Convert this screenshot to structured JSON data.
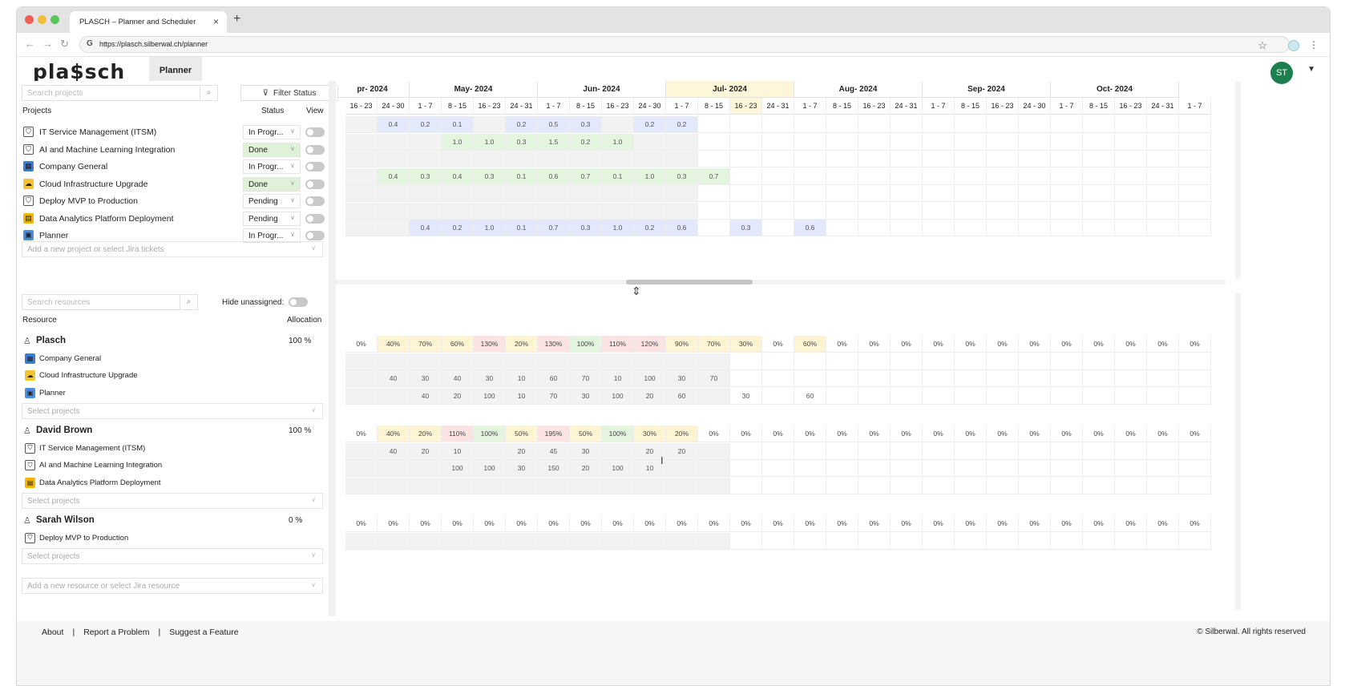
{
  "browser": {
    "tab_title": "PLASCH – Planner and Scheduler",
    "url": "https://plasch.silberwal.ch/planner"
  },
  "app": {
    "logo": "pla$sch",
    "nav_tab": "Planner",
    "avatar": "ST"
  },
  "projects_panel": {
    "search_placeholder": "Search projects",
    "filter_label": "Filter Status",
    "col_projects": "Projects",
    "col_status": "Status",
    "col_view": "View",
    "add_placeholder": "Add a new project or select Jira tickets",
    "rows": [
      {
        "name": "IT Service Management (ITSM)",
        "status": "In Progr...",
        "icon": "shield-check-icon",
        "color": "#ffffff"
      },
      {
        "name": "AI and Machine Learning Integration",
        "status": "Done",
        "icon": "shield-check-icon",
        "color": "#ffffff"
      },
      {
        "name": "Company General",
        "status": "In Progr...",
        "icon": "building-icon",
        "color": "#3b7dd8"
      },
      {
        "name": "Cloud Infrastructure Upgrade",
        "status": "Done",
        "icon": "cloud-icon",
        "color": "#f4c430"
      },
      {
        "name": "Deploy MVP to Production",
        "status": "Pending",
        "icon": "shield-check-icon",
        "color": "#ffffff"
      },
      {
        "name": "Data Analytics Platform Deployment",
        "status": "Pending",
        "icon": "chart-icon",
        "color": "#f4b400"
      },
      {
        "name": "Planner",
        "status": "In Progr...",
        "icon": "planner-icon",
        "color": "#4a90e2"
      }
    ]
  },
  "resources_panel": {
    "search_placeholder": "Search resources",
    "hide_label": "Hide unassigned:",
    "col_resource": "Resource",
    "col_allocation": "Allocation",
    "select_projects": "Select projects",
    "add_placeholder": "Add a new resource or select Jira resource",
    "resources": [
      {
        "name": "Plasch",
        "allocation": "100 %",
        "projects": [
          "Company General",
          "Cloud Infrastructure Upgrade",
          "Planner"
        ]
      },
      {
        "name": "David Brown",
        "allocation": "100 %",
        "projects": [
          "IT Service Management (ITSM)",
          "AI and Machine Learning Integration",
          "Data Analytics Platform Deployment"
        ]
      },
      {
        "name": "Sarah Wilson",
        "allocation": "0 %",
        "projects": [
          "Deploy MVP to Production"
        ]
      }
    ]
  },
  "timeline": {
    "months": [
      "pr- 2024",
      "May- 2024",
      "Jun- 2024",
      "Jul- 2024",
      "Aug- 2024",
      "Sep- 2024",
      "Oct- 2024"
    ],
    "weeks": [
      "16 - 23",
      "24 - 30",
      "1 - 7",
      "8 - 15",
      "16 - 23",
      "24 - 31",
      "1 - 7",
      "8 - 15",
      "16 - 23",
      "24 - 30",
      "1 - 7",
      "8 - 15",
      "16 - 23",
      "24 - 31",
      "1 - 7",
      "8 - 15",
      "16 - 23",
      "24 - 31",
      "1 - 7",
      "8 - 15",
      "16 - 23",
      "24 - 30",
      "1 - 7",
      "8 - 15",
      "16 - 23",
      "24 - 31",
      "1 - 7"
    ],
    "project_values": [
      [
        "",
        "0.4",
        "0.2",
        "0.1",
        "",
        "0.2",
        "0.5",
        "0.3",
        "",
        "0.2",
        "0.2",
        "",
        "",
        "",
        "",
        "",
        "",
        "",
        "",
        "",
        "",
        "",
        "",
        "",
        "",
        "",
        ""
      ],
      [
        "",
        "",
        "",
        "1.0",
        "1.0",
        "0.3",
        "1.5",
        "0.2",
        "1.0",
        "",
        "",
        "",
        "",
        "",
        "",
        "",
        "",
        "",
        "",
        "",
        "",
        "",
        "",
        "",
        "",
        "",
        ""
      ],
      [
        "",
        "",
        "",
        "",
        "",
        "",
        "",
        "",
        "",
        "",
        "",
        "",
        "",
        "",
        "",
        "",
        "",
        "",
        "",
        "",
        "",
        "",
        "",
        "",
        "",
        "",
        ""
      ],
      [
        "",
        "0.4",
        "0.3",
        "0.4",
        "0.3",
        "0.1",
        "0.6",
        "0.7",
        "0.1",
        "1.0",
        "0.3",
        "0.7",
        "",
        "",
        "",
        "",
        "",
        "",
        "",
        "",
        "",
        "",
        "",
        "",
        "",
        "",
        ""
      ],
      [
        "",
        "",
        "",
        "",
        "",
        "",
        "",
        "",
        "",
        "",
        "",
        "",
        "",
        "",
        "",
        "",
        "",
        "",
        "",
        "",
        "",
        "",
        "",
        "",
        "",
        "",
        ""
      ],
      [
        "",
        "",
        "",
        "",
        "",
        "",
        "",
        "",
        "",
        "",
        "",
        "",
        "",
        "",
        "",
        "",
        "",
        "",
        "",
        "",
        "",
        "",
        "",
        "",
        "",
        "",
        ""
      ],
      [
        "",
        "",
        "0.4",
        "0.2",
        "1.0",
        "0.1",
        "0.7",
        "0.3",
        "1.0",
        "0.2",
        "0.6",
        "",
        "0.3",
        "",
        "0.6",
        "",
        "",
        "",
        "",
        "",
        "",
        "",
        "",
        "",
        "",
        "",
        ""
      ]
    ],
    "plasch_pct": [
      "0%",
      "40%",
      "70%",
      "60%",
      "130%",
      "20%",
      "130%",
      "100%",
      "110%",
      "120%",
      "90%",
      "70%",
      "30%",
      "0%",
      "60%",
      "0%",
      "0%",
      "0%",
      "0%",
      "0%",
      "0%",
      "0%",
      "0%",
      "0%",
      "0%",
      "0%",
      "0%"
    ],
    "plasch_rows": [
      [
        "",
        "",
        "",
        "",
        "",
        "",
        "",
        "",
        "",
        "",
        "",
        "",
        "",
        "",
        "",
        "",
        "",
        "",
        "",
        "",
        "",
        "",
        "",
        "",
        "",
        "",
        ""
      ],
      [
        "",
        "40",
        "30",
        "40",
        "30",
        "10",
        "60",
        "70",
        "10",
        "100",
        "30",
        "70",
        "",
        "",
        "",
        "",
        "",
        "",
        "",
        "",
        "",
        "",
        "",
        "",
        "",
        "",
        ""
      ],
      [
        "",
        "",
        "40",
        "20",
        "100",
        "10",
        "70",
        "30",
        "100",
        "20",
        "60",
        "",
        "30",
        "",
        "60",
        "",
        "",
        "",
        "",
        "",
        "",
        "",
        "",
        "",
        "",
        "",
        ""
      ]
    ],
    "david_pct": [
      "0%",
      "40%",
      "20%",
      "110%",
      "100%",
      "50%",
      "195%",
      "50%",
      "100%",
      "30%",
      "20%",
      "0%",
      "0%",
      "0%",
      "0%",
      "0%",
      "0%",
      "0%",
      "0%",
      "0%",
      "0%",
      "0%",
      "0%",
      "0%",
      "0%",
      "0%",
      "0%"
    ],
    "david_rows": [
      [
        "",
        "40",
        "20",
        "10",
        "",
        "20",
        "45",
        "30",
        "",
        "20",
        "20",
        "",
        "",
        "",
        "",
        "",
        "",
        "",
        "",
        "",
        "",
        "",
        "",
        "",
        "",
        "",
        ""
      ],
      [
        "",
        "",
        "",
        "100",
        "100",
        "30",
        "150",
        "20",
        "100",
        "10",
        "",
        "",
        "",
        "",
        "",
        "",
        "",
        "",
        "",
        "",
        "",
        "",
        "",
        "",
        "",
        "",
        ""
      ],
      [
        "",
        "",
        "",
        "",
        "",
        "",
        "",
        "",
        "",
        "",
        "",
        "",
        "",
        "",
        "",
        "",
        "",
        "",
        "",
        "",
        "",
        "",
        "",
        "",
        "",
        "",
        ""
      ]
    ],
    "sarah_pct": [
      "0%",
      "0%",
      "0%",
      "0%",
      "0%",
      "0%",
      "0%",
      "0%",
      "0%",
      "0%",
      "0%",
      "0%",
      "0%",
      "0%",
      "0%",
      "0%",
      "0%",
      "0%",
      "0%",
      "0%",
      "0%",
      "0%",
      "0%",
      "0%",
      "0%",
      "0%",
      "0%"
    ],
    "sarah_rows": [
      [
        "",
        "",
        "",
        "",
        "",
        "",
        "",
        "",
        "",
        "",
        "",
        "",
        "",
        "",
        "",
        "",
        "",
        "",
        "",
        "",
        "",
        "",
        "",
        "",
        "",
        "",
        ""
      ]
    ]
  },
  "colors": {
    "blue": "#e3e8fb",
    "green": "#e3f5df",
    "yellow": "#fdf4d3",
    "red": "#fbe3e3",
    "grey": "#f2f2f2",
    "current_month": "#fdf6d8"
  },
  "footer": {
    "about": "About",
    "report": "Report a Problem",
    "suggest": "Suggest a Feature",
    "sep": "|",
    "copyright": "© Silberwal. All rights reserved"
  }
}
